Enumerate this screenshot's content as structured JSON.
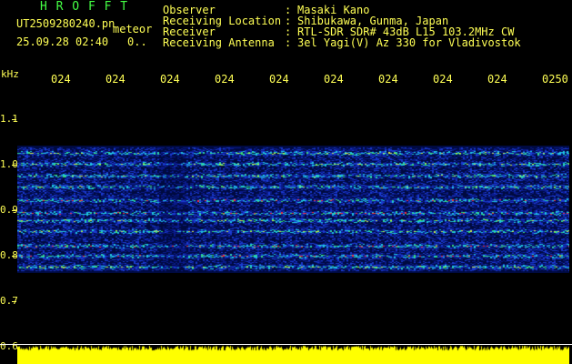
{
  "header": {
    "brand": "H R O F F T",
    "filename": "UT2509280240.pn",
    "meteor_label": "meteor",
    "datetime": "25.09.28 02:40",
    "count": "0..",
    "fields": [
      {
        "label": "Observer",
        "sep": ":",
        "value": "Masaki Kano"
      },
      {
        "label": "Receiving Location",
        "sep": ":",
        "value": "Shibukawa, Gunma, Japan"
      },
      {
        "label": "Receiver",
        "sep": ":",
        "value": "RTL-SDR SDR# 43dB L15 103.2MHz CW"
      },
      {
        "label": "Receiving Antenna",
        "sep": ":",
        "value": "3el Yagi(V) Az 330 for Vladivostok"
      }
    ]
  },
  "axis": {
    "unit": "kHz",
    "y_ticks": [
      "1.1",
      "1.0",
      "0.9",
      "0.8",
      "0.7",
      "0.6"
    ],
    "x_ticks": [
      "024",
      "024",
      "024",
      "024",
      "024",
      "024",
      "024",
      "024",
      "024",
      "0250"
    ]
  },
  "colors": {
    "label": "#ffff55",
    "brand": "#44ff44",
    "text": "#ffffff",
    "spectrogram_bg": "#0a1a8a",
    "signal_yellow": "#ffff00"
  }
}
